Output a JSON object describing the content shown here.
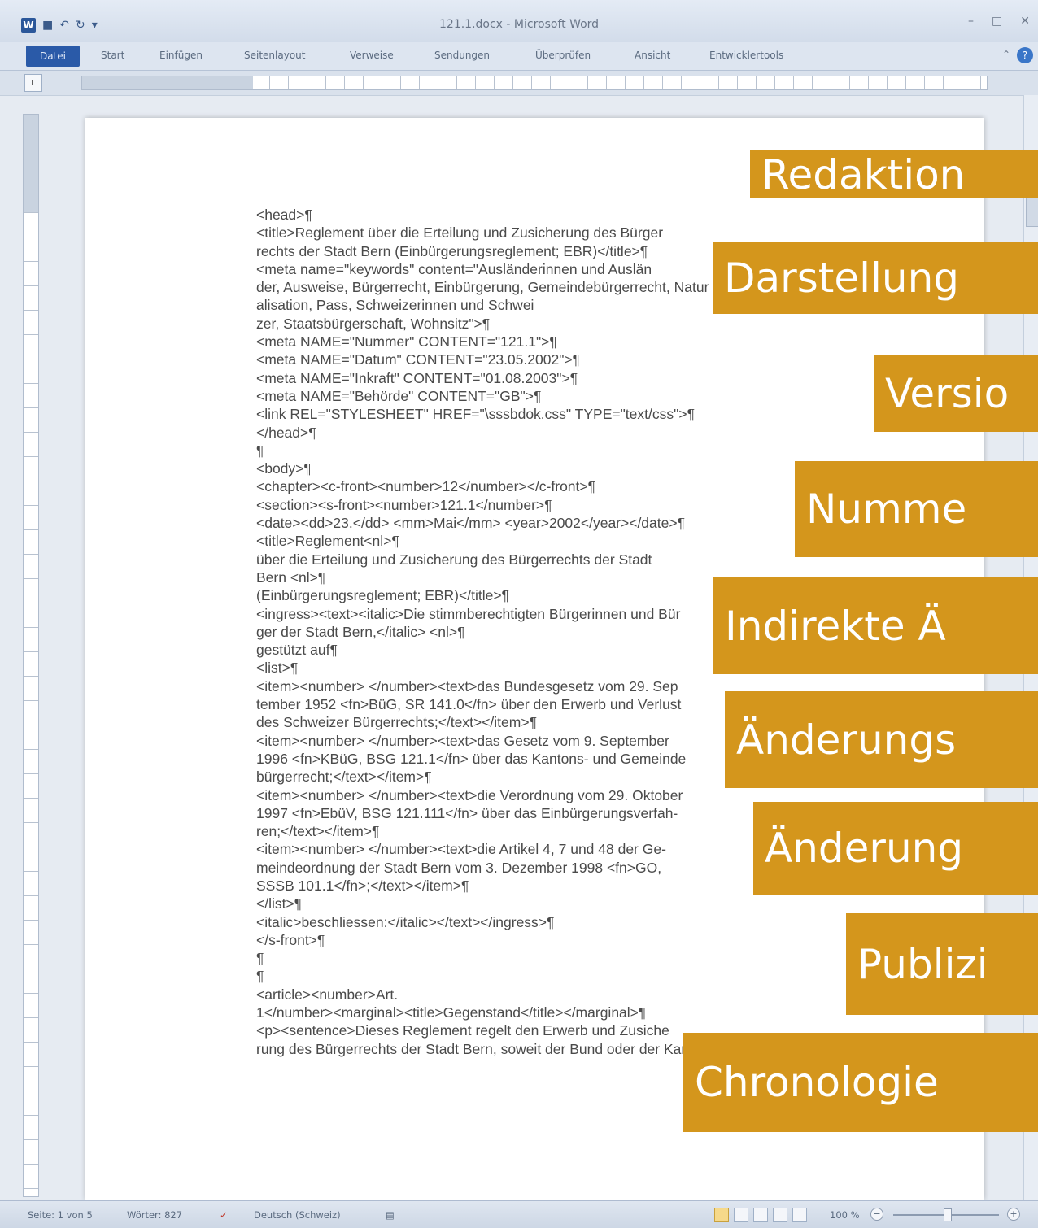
{
  "window": {
    "title": "121.1.docx - Microsoft Word",
    "app_icon": "W",
    "controls": [
      "–",
      "□",
      "✕"
    ]
  },
  "quick_access": [
    "save-icon",
    "undo-icon",
    "redo-icon",
    "customize-icon"
  ],
  "ribbon": {
    "tabs": [
      "Datei",
      "Start",
      "Einfügen",
      "Seitenlayout",
      "Verweise",
      "Sendungen",
      "Überprüfen",
      "Ansicht",
      "Entwicklertools"
    ],
    "help": "?"
  },
  "document": {
    "lines": [
      "<head>¶",
      "<title>Reglement über die Erteilung und Zusicherung des Bürger",
      "rechts der Stadt Bern (Einbürgerungsreglement; EBR)</title>¶",
      "<meta name=\"keywords\" content=\"Ausländerinnen und Auslän",
      "der, Ausweise, Bürgerrecht, Einbürgerung, Gemeindebürgerrecht, Natur",
      "alisation, Pass, Schweizerinnen und Schwei",
      "zer, Staatsbürgerschaft, Wohnsitz\">¶",
      "<meta NAME=\"Nummer\" CONTENT=\"121.1\">¶",
      "<meta NAME=\"Datum\" CONTENT=\"23.05.2002\">¶",
      "<meta NAME=\"Inkraft\" CONTENT=\"01.08.2003\">¶",
      "<meta NAME=\"Behörde\" CONTENT=\"GB\">¶",
      "<link REL=\"STYLESHEET\" HREF=\"\\sssbdok.css\" TYPE=\"text/css\">¶",
      "</head>¶",
      "¶",
      "<body>¶",
      "<chapter><c-front><number>12</number></c-front>¶",
      "<section><s-front><number>121.1</number>¶",
      "<date><dd>23.</dd> <mm>Mai</mm> <year>2002</year></date>¶",
      "<title>Reglement<nl>¶",
      "über die Erteilung und Zusicherung des Bürgerrechts der Stadt",
      "Bern <nl>¶",
      "(Einbürgerungsreglement; EBR)</title>¶",
      "<ingress><text><italic>Die stimmberechtigten Bürgerinnen und Bür",
      "ger der Stadt Bern,</italic> <nl>¶",
      "gestützt auf¶",
      "<list>¶",
      "<item><number> </number><text>das Bundesgesetz vom 29. Sep",
      "tember 1952 <fn>BüG, SR 141.0</fn> über den Erwerb und Verlust",
      "des Schweizer Bürgerrechts;</text></item>¶",
      "<item><number> </number><text>das Gesetz vom 9. September",
      "1996 <fn>KBüG, BSG 121.1</fn> über das Kantons- und Gemeinde",
      "bürgerrecht;</text></item>¶",
      "<item><number> </number><text>die Verordnung vom 29. Oktober",
      "1997 <fn>EbüV, BSG 121.111</fn> über das Einbürgerungsverfah-",
      "ren;</text></item>¶",
      "<item><number> </number><text>die Artikel 4, 7 und 48 der Ge-",
      "meindeordnung der Stadt Bern vom 3. Dezember 1998 <fn>GO,",
      "SSSB 101.1</fn>;</text></item>¶",
      "</list>¶",
      "<italic>beschliessen:</italic></text></ingress>¶",
      "</s-front>¶",
      "¶",
      "¶",
      "<article><number>Art.",
      "1</number><marginal><title>Gegenstand</title></marginal>¶",
      "<p><sentence>Dieses Reglement regelt den Erwerb und Zusiche",
      "rung des Bürgerrechts der Stadt Bern, soweit der Bund oder der Kan-"
    ]
  },
  "overlay_labels": [
    "Redaktion",
    "Darstellung",
    "Versio",
    "Numme",
    "Indirekte Ä",
    "Änderungs",
    "Änderung",
    "Publizi",
    "Chronologie"
  ],
  "status": {
    "page": "Seite: 1 von 5",
    "words": "Wörter: 827",
    "language": "Deutsch (Schweiz)",
    "zoom": "100 %",
    "zoom_minus": "−",
    "zoom_plus": "+"
  },
  "colors": {
    "label_bg": "#d4961c",
    "word_blue": "#2b579a"
  }
}
